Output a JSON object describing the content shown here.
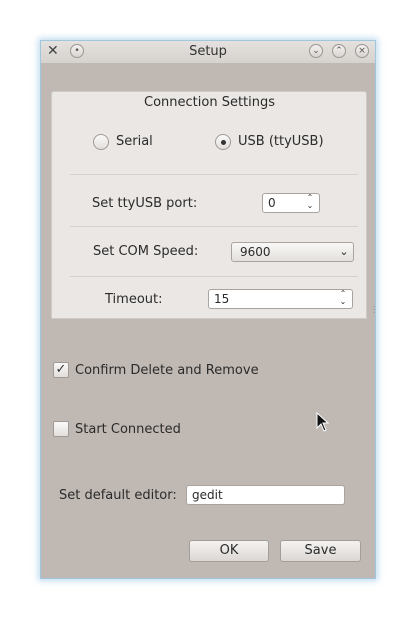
{
  "window": {
    "title": "Setup",
    "icons": {
      "app": "app-icon",
      "menu": "window-menu-icon",
      "minimize": "minimize-icon",
      "maximize": "maximize-icon",
      "close": "close-icon"
    }
  },
  "connection": {
    "title": "Connection Settings",
    "serial_label": "Serial",
    "usb_label": "USB (ttyUSB)",
    "selected": "USB (ttyUSB)",
    "tty_port_label": "Set ttyUSB port:",
    "tty_port_value": "0",
    "com_speed_label": "Set COM Speed:",
    "com_speed_value": "9600",
    "timeout_label": "Timeout:",
    "timeout_value": "15"
  },
  "options": {
    "confirm_delete_label": "Confirm Delete and Remove",
    "confirm_delete_checked": true,
    "start_connected_label": "Start Connected",
    "start_connected_checked": false
  },
  "editor": {
    "label": "Set default editor:",
    "value": "gedit"
  },
  "buttons": {
    "ok_label": "OK",
    "save_label": "Save"
  }
}
